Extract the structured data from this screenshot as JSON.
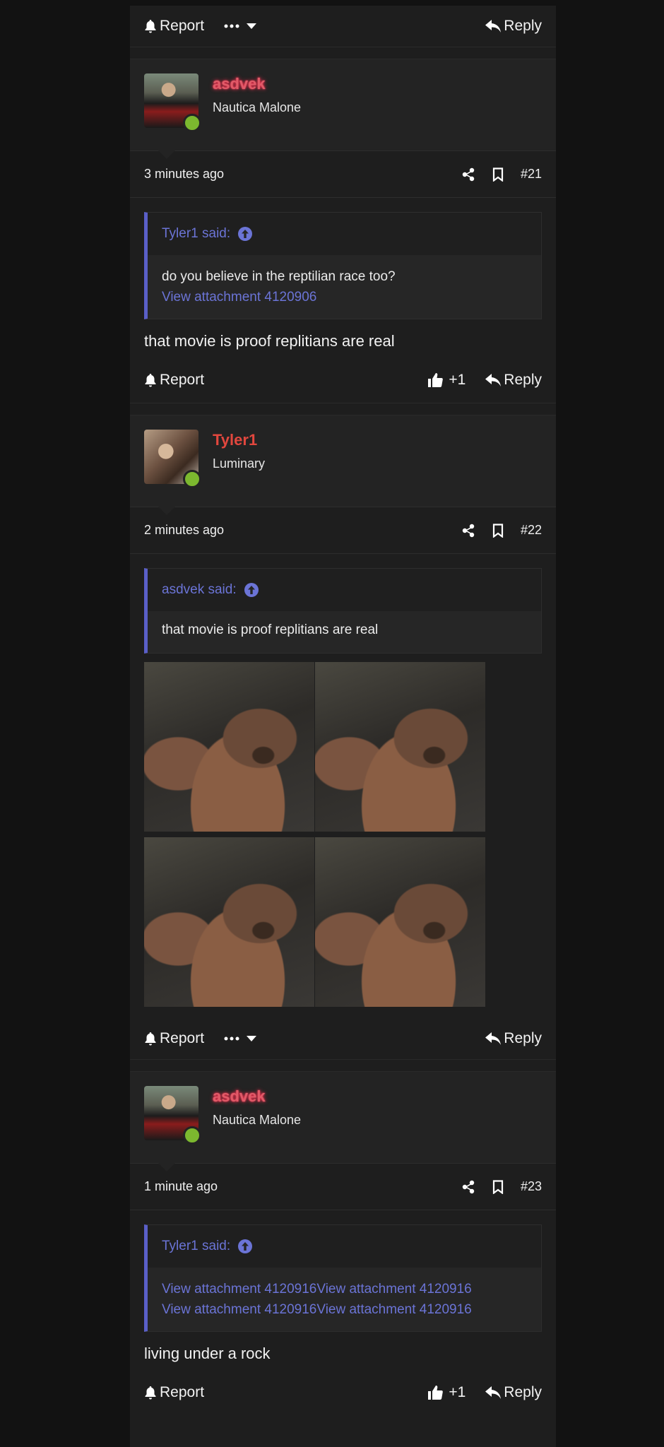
{
  "actions": {
    "report": "Report",
    "reply": "Reply",
    "like_count": "+1"
  },
  "posts": [
    {
      "username": "asdvek",
      "user_title": "Nautica Malone",
      "time": "3 minutes ago",
      "number": "#21",
      "quote": {
        "author": "Tyler1 said:",
        "lines": [
          "do you believe in the reptilian race too?"
        ],
        "links": [
          "View attachment 4120906"
        ]
      },
      "message": "that movie is proof replitians are real"
    },
    {
      "username": "Tyler1",
      "user_title": "Luminary",
      "time": "2 minutes ago",
      "number": "#22",
      "quote": {
        "author": "asdvek said:",
        "lines": [
          "that movie is proof replitians are real"
        ]
      },
      "image_count": 4
    },
    {
      "username": "asdvek",
      "user_title": "Nautica Malone",
      "time": "1 minute ago",
      "number": "#23",
      "quote": {
        "author": "Tyler1 said:",
        "links": [
          "View attachment 4120916",
          "View attachment 4120916",
          "View attachment 4120916",
          "View attachment 4120916"
        ]
      },
      "message": "living under a rock"
    }
  ]
}
